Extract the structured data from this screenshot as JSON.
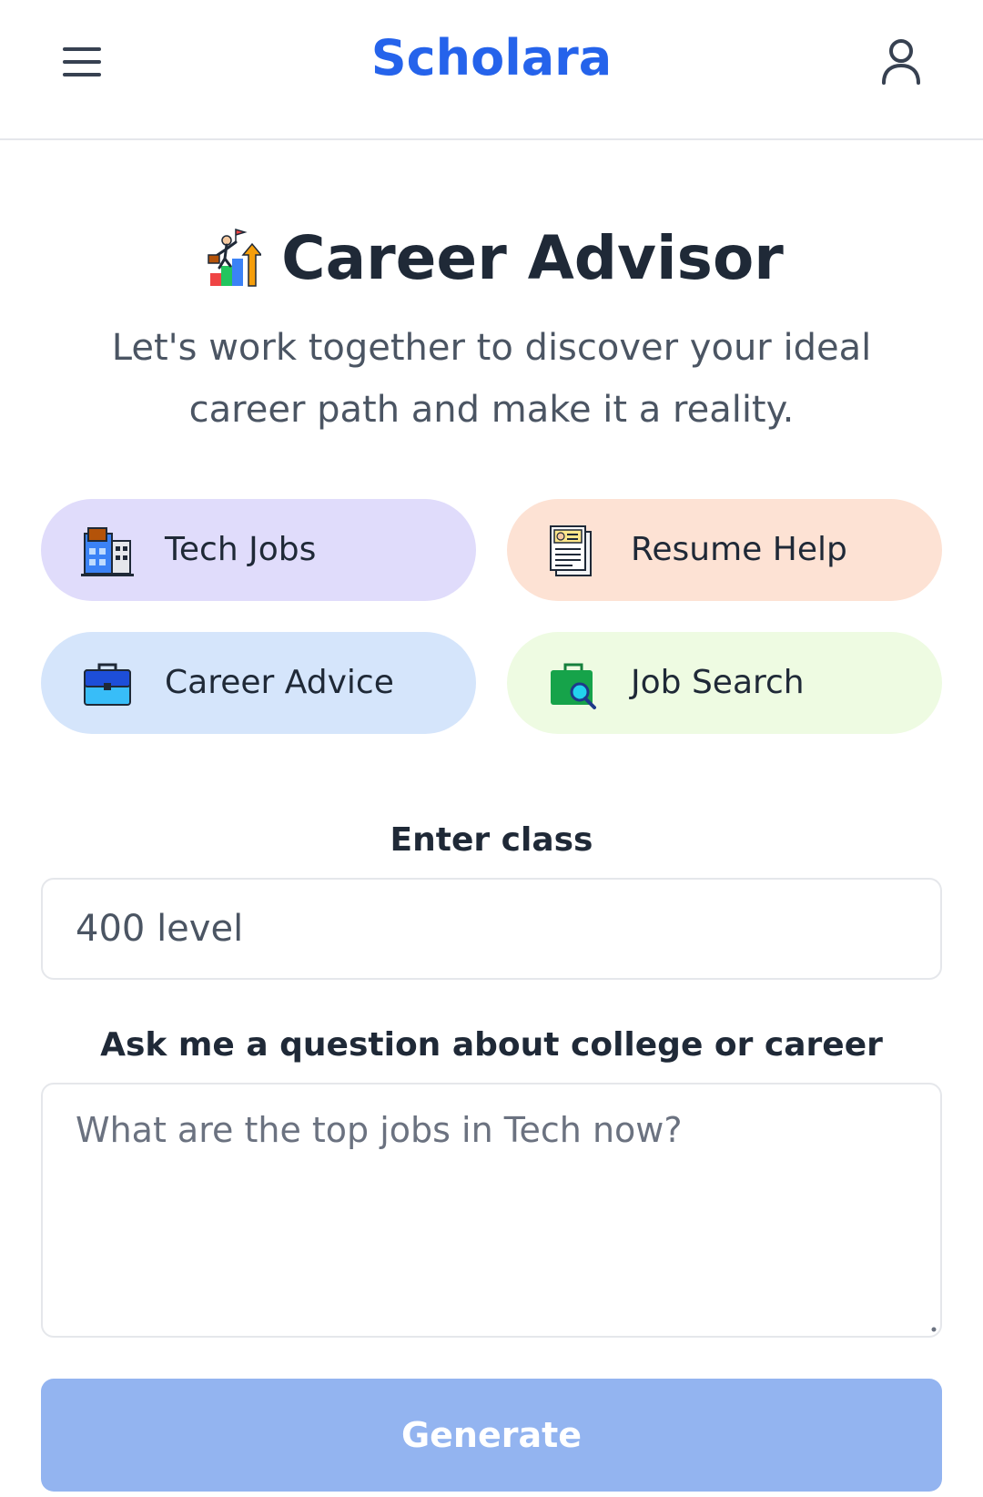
{
  "header": {
    "brand": "Scholara",
    "menu_icon": "hamburger-menu-icon",
    "profile_icon": "user-profile-icon"
  },
  "hero": {
    "icon": "career-climb-icon",
    "title": "Career Advisor",
    "subtitle": "Let's work together to discover your ideal career path and make it a reality."
  },
  "quick_actions": [
    {
      "label": "Tech Jobs",
      "icon": "office-building-icon",
      "color": "#e0dcfb"
    },
    {
      "label": "Resume Help",
      "icon": "resume-document-icon",
      "color": "#fde2d4"
    },
    {
      "label": "Career Advice",
      "icon": "briefcase-icon",
      "color": "#d5e5fb"
    },
    {
      "label": "Job Search",
      "icon": "briefcase-search-icon",
      "color": "#eefbe2"
    }
  ],
  "form": {
    "class_label": "Enter class",
    "class_value": "400 level",
    "question_label": "Ask me a question about college or career",
    "question_placeholder": "What are the top jobs in Tech now?",
    "generate_label": "Generate"
  },
  "colors": {
    "brand": "#2563eb",
    "button_disabled": "#93b4f0",
    "text_dark": "#1f2937",
    "text_muted": "#4b5563"
  }
}
